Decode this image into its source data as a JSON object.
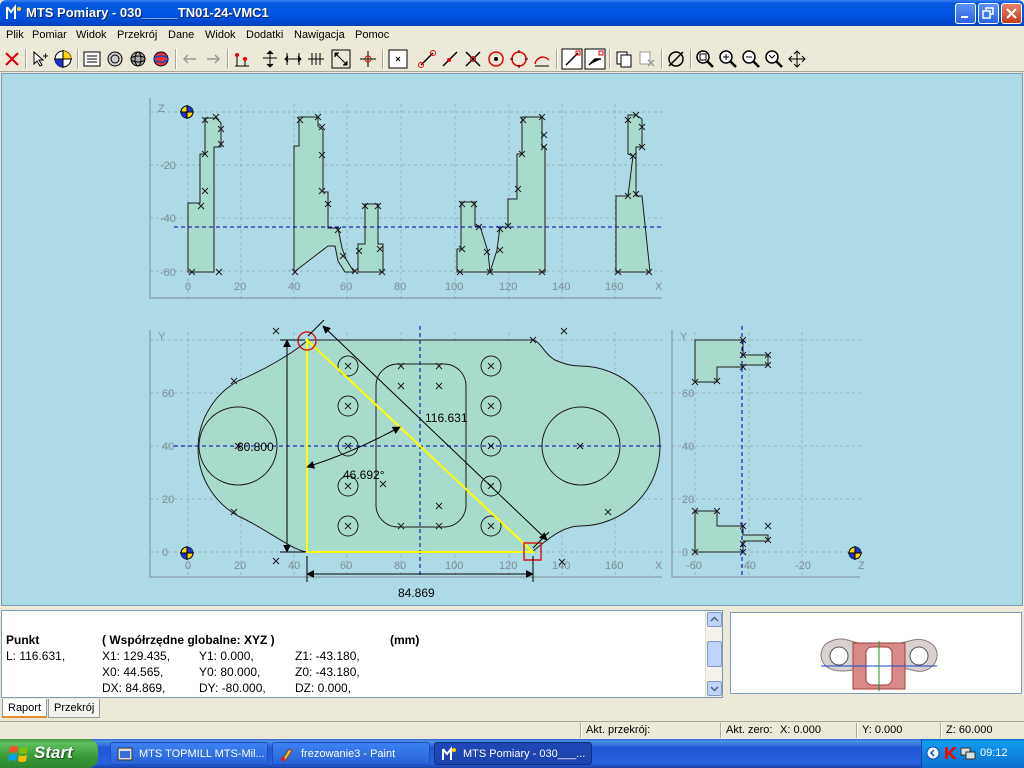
{
  "window": {
    "title": "MTS Pomiary - 030_____TN01-24-VMC1"
  },
  "menu": [
    "Plik",
    "Pomiar",
    "Widok",
    "Przekrój",
    "Dane",
    "Widok",
    "Dodatki",
    "Nawigacja",
    "Pomoc"
  ],
  "toolbar": {
    "icons": [
      "delete-icon",
      "select-icon",
      "origin-icon",
      "list-icon",
      "circles-icon",
      "sphere-icon",
      "sphere-color-icon",
      "undo-arrow-icon",
      "redo-arrow-icon",
      "points-icon",
      "dim-vertical-icon",
      "dim-horizontal-icon",
      "dim-symmetric-icon",
      "dim-diagonal-icon",
      "center-icon",
      "point-box-icon",
      "line-two-points-icon",
      "line-icon",
      "intersection-icon",
      "circle-center-icon",
      "circle-icon",
      "arc-icon",
      "segment-icon",
      "segment-angle-icon",
      "copy-icon",
      "delete-selection-icon",
      "diameter-icon",
      "zoom-window-icon",
      "zoom-in-icon",
      "zoom-out-icon",
      "zoom-all-icon",
      "pan-icon"
    ]
  },
  "drawing": {
    "top_view": {
      "axis_z_label": "Z",
      "axis_x_label": "X",
      "y_ticks": [
        "-20",
        "-40",
        "-60"
      ],
      "x_ticks": [
        "0",
        "20",
        "40",
        "60",
        "80",
        "100",
        "120",
        "140",
        "160"
      ]
    },
    "main_view": {
      "axis_y_label": "Y",
      "axis_x_label": "X",
      "y_ticks": [
        "60",
        "40",
        "20",
        "0"
      ],
      "x_ticks": [
        "0",
        "20",
        "40",
        "60",
        "80",
        "100",
        "120",
        "140",
        "160"
      ],
      "dim_diameter": "80.800",
      "dim_length": "116.631",
      "dim_angle": "46.692°",
      "dim_horizontal": "84.869"
    },
    "side_view": {
      "axis_y_label": "Y",
      "axis_z_label": "Z",
      "y_ticks": [
        "60",
        "40",
        "20",
        "0"
      ],
      "z_ticks": [
        "-60",
        "-40",
        "-20"
      ]
    },
    "colors": {
      "background": "#acdae5",
      "part_fill": "#a7dccc",
      "outline": "#1c1c1c",
      "selection": "#ffff00",
      "marker": "#d81818",
      "grid": "#8aa6ad",
      "center_line": "#0000b0"
    }
  },
  "report": {
    "punkt_label": "Punkt",
    "coords_header": "( Współrzędne globalne: XYZ )",
    "units": "(mm)",
    "l_value": "L: 116.631,",
    "row1": [
      "X1: 129.435,",
      "Y1: 0.000,",
      "Z1: -43.180,"
    ],
    "row2": [
      "X0: 44.565,",
      "Y0: 80.000,",
      "Z0: -43.180,"
    ],
    "row3": [
      "DX: 84.869,",
      "DY: -80.000,",
      "DZ: 0.000,"
    ]
  },
  "tabs": [
    "Raport",
    "Przekrój"
  ],
  "status": {
    "akt_przekroj": "Akt. przekrój:",
    "akt_zero": "Akt. zero:",
    "x": "X:  0.000",
    "y": "Y:  0.000",
    "z": "Z:  60.000"
  },
  "taskbar": {
    "start": "Start",
    "tasks": [
      "MTS TOPMILL MTS-Mil...",
      "frezowanie3 - Paint",
      "MTS Pomiary - 030___..."
    ],
    "clock": "09:12"
  }
}
